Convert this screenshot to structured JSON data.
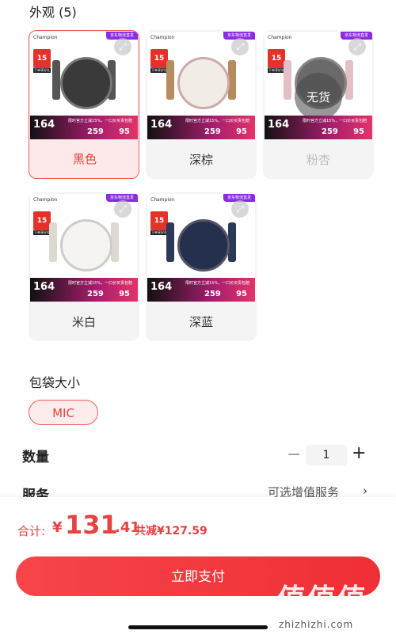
{
  "appearance": {
    "title": "外观 (5)",
    "variants": [
      {
        "label": "黑色",
        "state": "selected",
        "bag_color": "#3a3a3a",
        "strap_color": "#555"
      },
      {
        "label": "深棕",
        "state": "normal",
        "bag_color": "#f1ede6",
        "strap_color": "#b88b5e"
      },
      {
        "label": "粉杏",
        "state": "disabled",
        "bag_color": "#6a6a6a",
        "strap_color": "#e3c0c6",
        "badge": "无货"
      },
      {
        "label": "米白",
        "state": "normal",
        "bag_color": "#f6f4f0",
        "strap_color": "#ddd8d0"
      },
      {
        "label": "深蓝",
        "state": "normal",
        "bag_color": "#24304d",
        "strap_color": "#2c3a58"
      }
    ],
    "thumb_text": {
      "brand": "Champion",
      "tag": "京东物流直发",
      "promo": "15",
      "promo_caption": "下单享好礼",
      "price": "164",
      "note": "限时官方立减15%，一口价买贵包赔",
      "n1": "259",
      "n2": "95"
    }
  },
  "bag_size": {
    "title": "包袋大小",
    "selected": "MIC"
  },
  "quantity": {
    "label": "数量",
    "value": "1",
    "minus": "−",
    "plus": "+"
  },
  "service": {
    "label": "服务",
    "value": "可选增值服务",
    "chevron": "›"
  },
  "footer": {
    "total_label": "合计:",
    "currency": "¥",
    "total_int": "131",
    "total_dec": ".41",
    "discount": "共减¥127.59",
    "pay_label": "立即支付"
  },
  "watermark": {
    "text": "值值值",
    "sub": "zhizhizhi.com"
  },
  "colors": {
    "accent": "#e54242",
    "selected_bg": "#fde9e9"
  }
}
